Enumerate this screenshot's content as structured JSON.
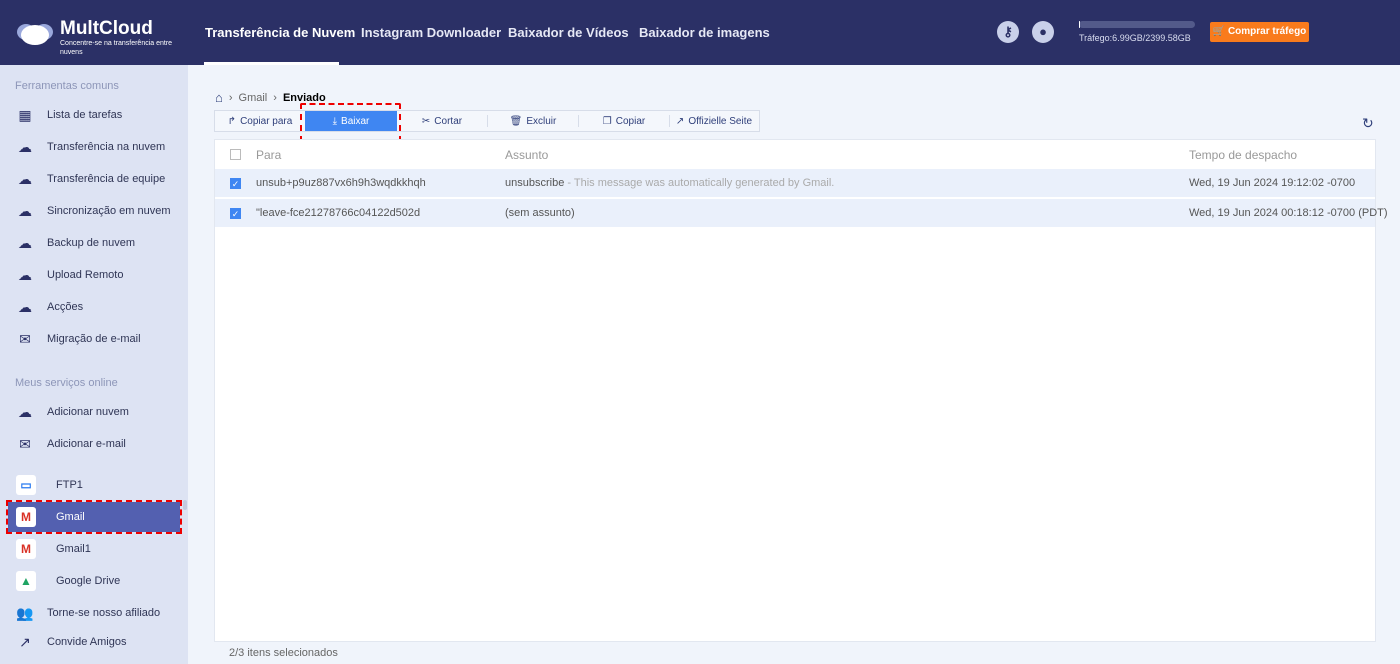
{
  "header": {
    "brand": "MultCloud",
    "tagline": "Concentre-se na transferência entre nuvens",
    "nav": [
      "Transferência de Nuvem",
      "Instagram Downloader",
      "Baixador de Vídeos",
      "Baixador de imagens"
    ],
    "traffic": "Tráfego:6.99GB/2399.58GB",
    "traffic_used_fraction": 0.003,
    "buy": "Comprar tráfego"
  },
  "sidebar": {
    "section1": "Ferramentas comuns",
    "tools": [
      "Lista de tarefas",
      "Transferência na nuvem",
      "Transferência de equipe",
      "Sincronização em nuvem",
      "Backup de nuvem",
      "Upload Remoto",
      "Acções",
      "Migração de e-mail"
    ],
    "section2": "Meus serviços online",
    "add": [
      "Adicionar nuvem",
      "Adicionar e-mail"
    ],
    "services": [
      "FTP1",
      "Gmail",
      "Gmail1",
      "Google Drive"
    ],
    "extra": [
      "Torne-se nosso afiliado",
      "Convide Amigos"
    ]
  },
  "breadcrumb": [
    "Gmail",
    "Enviado"
  ],
  "toolbar": [
    "Copiar para",
    "Baixar",
    "Cortar",
    "Excluir",
    "Copiar",
    "Offizielle Seite"
  ],
  "table": {
    "headers": [
      "Para",
      "Assunto",
      "Tempo de despacho"
    ],
    "rows": [
      {
        "to": "unsub+p9uz887vx6h9h3wqdkkhqh",
        "subject": "unsubscribe",
        "snippet": " - This message was automatically generated by Gmail.",
        "time": "Wed, 19 Jun 2024 19:12:02 -0700",
        "checked": true
      },
      {
        "to": "\"leave-fce21278766c04122d502d",
        "subject": "(sem assunto)",
        "snippet": "",
        "time": "Wed, 19 Jun 2024 00:18:12 -0700 (PDT)",
        "checked": true
      }
    ]
  },
  "footer": "2/3 itens selecionados"
}
